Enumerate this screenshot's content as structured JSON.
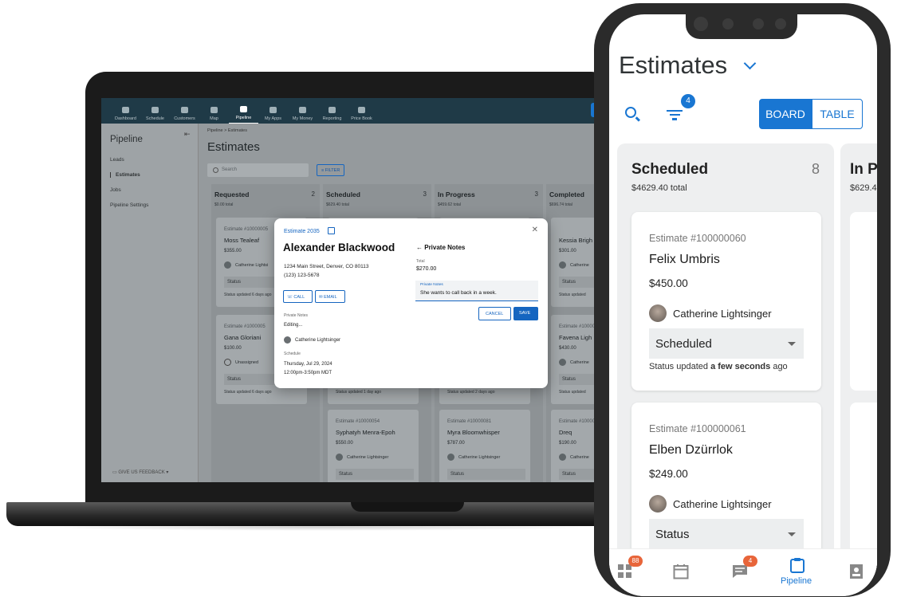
{
  "desktop": {
    "nav": [
      "Dashboard",
      "Schedule",
      "Customers",
      "Map",
      "Pipeline",
      "My Apps",
      "My Money",
      "Reporting",
      "Price Book"
    ],
    "new_btn": "+ N",
    "sidebar": {
      "title": "Pipeline",
      "items": [
        "Leads",
        "Estimates",
        "Jobs",
        "Pipeline Settings"
      ],
      "feedback": "GIVE US FEEDBACK"
    },
    "breadcrumb": "Pipeline > Estimates",
    "page_title": "Estimates",
    "search_placeholder": "Search",
    "filter_label": "FILTER",
    "columns": [
      {
        "title": "Requested",
        "count": "2",
        "total": "$0.00 total",
        "cards": [
          {
            "est": "Estimate #10000005",
            "name": "Moss Tealeaf",
            "price": "$355.00",
            "user": "Catherine Lightsi",
            "status": "Status",
            "updated": "Status updated 6 days ago"
          },
          {
            "est": "Estimate #1000005",
            "name": "Gana Gloriani",
            "price": "$100.00",
            "user": "Unassigned",
            "status": "Status",
            "updated": "Status updated 6 days ago"
          }
        ]
      },
      {
        "title": "Scheduled",
        "count": "3",
        "total": "$629.40 total",
        "cards": [
          {
            "est": "",
            "name": "",
            "price": "",
            "user": "",
            "status": "",
            "updated": ""
          },
          {
            "est": "",
            "name": "",
            "price": "",
            "user": "",
            "status": "",
            "updated": "Status updated 1 day ago"
          },
          {
            "est": "Estimate #10000054",
            "name": "Syphatyh Menra-Epoh",
            "price": "$550.00",
            "user": "Catherine Lightsinger",
            "status": "Status",
            "updated": ""
          }
        ]
      },
      {
        "title": "In Progress",
        "count": "3",
        "total": "$459.62 total",
        "cards": [
          {
            "est": "",
            "name": "",
            "price": "",
            "user": "",
            "status": "",
            "updated": ""
          },
          {
            "est": "",
            "name": "",
            "price": "",
            "user": "",
            "status": "",
            "updated": "Status updated 2 days ago"
          },
          {
            "est": "Estimate #10000081",
            "name": "Myra Bloomwhisper",
            "price": "$787.00",
            "user": "Catherine Lightsinger",
            "status": "Status",
            "updated": ""
          }
        ]
      },
      {
        "title": "Completed",
        "count": "",
        "total": "$696.74 total",
        "cards": [
          {
            "est": "",
            "name": "Kessia Brigh",
            "price": "$301.00",
            "user": "Catherine",
            "status": "Status",
            "updated": "Status updated"
          },
          {
            "est": "Estimate #100000",
            "name": "Favena Ligh",
            "price": "$430.00",
            "user": "Catherine",
            "status": "Status",
            "updated": "Status updated"
          },
          {
            "est": "Estimate #100000",
            "name": "Dreq",
            "price": "$190.00",
            "user": "Catherine",
            "status": "Status",
            "updated": ""
          }
        ]
      }
    ],
    "modal": {
      "estimate_link": "Estimate 2035",
      "customer": "Alexander Blackwood",
      "address": "1234 Main Street, Denver, CO 80113",
      "phone": "(123) 123-5678",
      "call": "CALL",
      "email": "EMAIL",
      "private_notes_label": "Private Notes",
      "private_notes_value": "Editing...",
      "user": "Catherine Lightsinger",
      "schedule_label": "Schedule",
      "schedule_date": "Thursday, Jul 29, 2024",
      "schedule_time": "12:00pm-3:50pm MDT",
      "pn_title": "Private Notes",
      "total_label": "Total",
      "total_value": "$270.00",
      "field_label": "Private Notes",
      "field_value": "She wants to call back in a week.",
      "cancel": "CANCEL",
      "save": "SAVE"
    }
  },
  "mobile": {
    "title": "Estimates",
    "filter_badge": "4",
    "board": "BOARD",
    "table": "TABLE",
    "column": {
      "title": "Scheduled",
      "count": "8",
      "total": "$4629.40 total"
    },
    "next_column": {
      "title": "In P",
      "total": "$629.4"
    },
    "cards": [
      {
        "est": "Estimate #100000060",
        "name": "Felix Umbris",
        "price": "$450.00",
        "user": "Catherine Lightsinger",
        "status": "Scheduled",
        "updated_pre": "Status updated ",
        "updated_bold": "a few seconds",
        "updated_post": " ago"
      },
      {
        "est": "Estimate #100000061",
        "name": "Elben Dzürrlok",
        "price": "$249.00",
        "user": "Catherine Lightsinger",
        "status": "Status"
      }
    ],
    "tabbar": {
      "badge_home": "88",
      "badge_msg": "4",
      "pipeline": "Pipeline"
    }
  },
  "colors": {
    "accent": "#1976d2",
    "badge": "#e8653a",
    "nav": "#1f3a47"
  }
}
